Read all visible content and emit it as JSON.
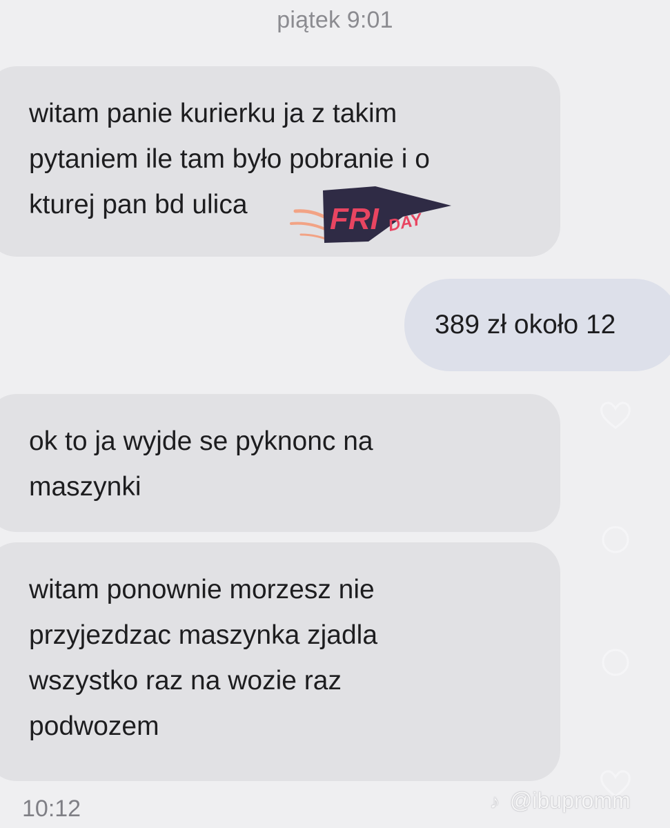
{
  "conversation": {
    "date_header": "piątek 9:01",
    "messages": [
      {
        "direction": "incoming",
        "lines": [
          "witam panie kurierku ja z takim",
          "pytaniem ile tam było pobranie i o",
          "kturej pan bd ulica "
        ]
      },
      {
        "direction": "outgoing",
        "lines": [
          "389 zł około 12"
        ]
      },
      {
        "direction": "incoming",
        "lines": [
          "ok to ja wyjde se pyknonc na",
          "maszynki"
        ]
      },
      {
        "direction": "incoming",
        "lines": [
          "witam ponownie morzesz nie",
          "przyjezdzac maszynka zjadla",
          "wszystko raz na wozie raz",
          "podwozem"
        ]
      }
    ],
    "last_time": "10:12"
  },
  "sticker": {
    "text_main": "FRI",
    "text_tail": "DAY",
    "colors": {
      "banner": "#2f2b45",
      "text": "#e84561",
      "flare": "#f2a385"
    }
  },
  "watermark": {
    "icon": "tiktok-icon",
    "handle": "@ibupromm"
  },
  "colors": {
    "background": "#efeff1",
    "incoming_bubble": "#e1e1e4",
    "outgoing_bubble": "#dde0ea",
    "timestamp": "#8b8b90"
  }
}
